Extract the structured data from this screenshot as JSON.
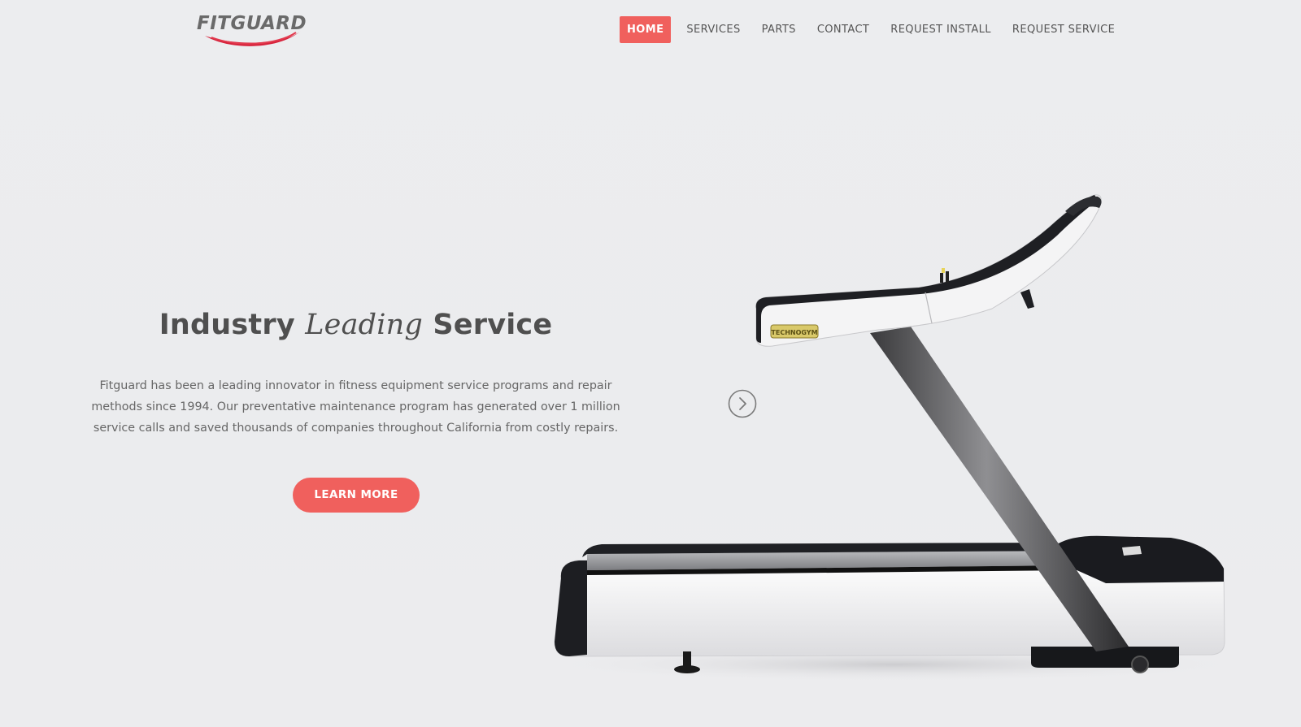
{
  "header": {
    "logo_text": "FITGUARD",
    "nav": [
      {
        "label": "HOME",
        "active": true
      },
      {
        "label": "SERVICES",
        "active": false
      },
      {
        "label": "PARTS",
        "active": false
      },
      {
        "label": "CONTACT",
        "active": false
      },
      {
        "label": "REQUEST INSTALL",
        "active": false
      },
      {
        "label": "REQUEST SERVICE",
        "active": false
      }
    ]
  },
  "hero": {
    "title_part1": "Industry ",
    "title_italic": "Leading",
    "title_part2": " Service",
    "description": "Fitguard has been a leading innovator in fitness equipment service programs and repair methods since 1994. Our preventative maintenance program has generated over 1 million service calls and saved thousands of companies throughout California from costly repairs.",
    "cta_label": "LEARN MORE",
    "product_brand_label": "TECHNOGYM"
  },
  "colors": {
    "accent": "#f0605d",
    "text_dark": "#4f4f4f",
    "text_body": "#666666",
    "background": "#ececee"
  },
  "icons": {
    "slider_next": "chevron-right-circle-icon"
  }
}
